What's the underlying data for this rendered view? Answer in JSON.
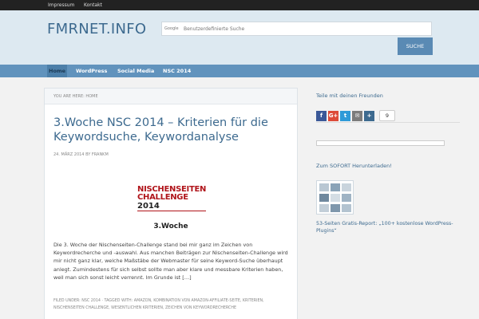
{
  "topbar": {
    "links": [
      "Impressum",
      "Kontakt"
    ]
  },
  "header": {
    "site_title": "FMRNET.INFO",
    "search_brand": "Google",
    "search_placeholder": "Benutzerdefinierte Suche",
    "search_button": "SUCHE"
  },
  "nav": {
    "items": [
      "Home",
      "WordPress",
      "Social Media",
      "NSC 2014"
    ]
  },
  "article": {
    "breadcrumb": "YOU ARE HERE: HOME",
    "title": "3.Woche NSC 2014 – Kriterien für die Keywordsuche, Keywordanalyse",
    "meta": "24. MÄRZ 2014 BY FRANKM",
    "logo_line1": "NISCHENSEITEN",
    "logo_line2": "CHALLENGE",
    "logo_year": "2014",
    "subheading": "3.Woche",
    "excerpt": "Die 3. Woche der Nischenseiten-Challenge stand bei mir ganz im Zeichen von Keywordrecherche und -auswahl. Aus manchen Beiträgen zur Nischenseiten-Challenge wird mir nicht ganz klar, welche Maßstäbe der Webmaster für seine Keyword-Suche überhaupt anlegt. Zumindestens für sich selbst sollte man aber klare und messbare Kriterien haben, weil man sich sonst leicht verrennt. Im Grunde ist […]",
    "footer": "FILED UNDER: NSC 2014 · TAGGED WITH: AMAZON, KOMBINATION VON AMAZON-AFFILIATE-SEITE, KRITERIEN, NISCHENSEITEN CHALLENGE, WESENTLICHEN KRITERIEN, ZEICHEN VON KEYWORDRECHERCHE"
  },
  "sidebar": {
    "share_title": "Teile mit deinen Freunden",
    "share_buttons": [
      {
        "icon": "facebook-icon",
        "label": "f",
        "color": "#3b5998"
      },
      {
        "icon": "googleplus-icon",
        "label": "G+",
        "color": "#dd4b39"
      },
      {
        "icon": "twitter-icon",
        "label": "t",
        "color": "#2f9ad8"
      },
      {
        "icon": "email-icon",
        "label": "✉",
        "color": "#7c7c7c"
      },
      {
        "icon": "more-icon",
        "label": "+",
        "color": "#3d6a8f"
      }
    ],
    "share_count": "9",
    "download_title": "Zum SOFORT Herunterladen!",
    "download_text": "53-Seiten Gratis-Report: „100+ kostenlose WordPress-Plugins“"
  }
}
